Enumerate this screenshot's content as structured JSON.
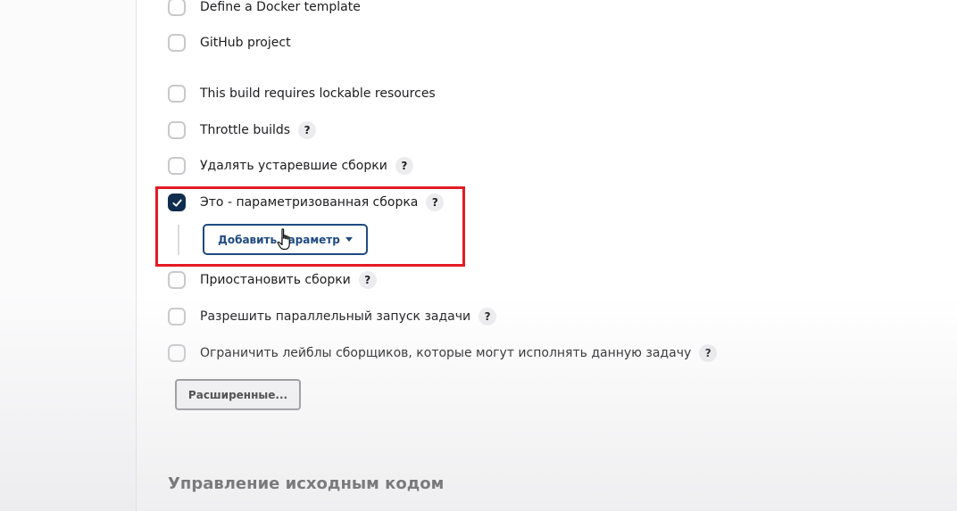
{
  "options": [
    {
      "label": "Define a Docker template",
      "checked": false,
      "help": false
    },
    {
      "label": "GitHub project",
      "checked": false,
      "help": false
    },
    {
      "label": "This build requires lockable resources",
      "checked": false,
      "help": false
    },
    {
      "label": "Throttle builds",
      "checked": false,
      "help": true
    },
    {
      "label": "Удалять устаревшие сборки",
      "checked": false,
      "help": true
    },
    {
      "label": "Это - параметризованная сборка",
      "checked": true,
      "help": true
    },
    {
      "label": "Приостановить сборки",
      "checked": false,
      "help": true
    },
    {
      "label": "Разрешить параллельный запуск задачи",
      "checked": false,
      "help": true
    },
    {
      "label": "Ограничить лейблы сборщиков, которые могут исполнять данную задачу",
      "checked": false,
      "help": true
    }
  ],
  "help_symbol": "?",
  "add_parameter_button": {
    "label": "Добавить параметр",
    "icon": "caret-down-icon"
  },
  "advanced_button": {
    "label": "Расширенные..."
  },
  "section_title": "Управление исходным кодом",
  "colors": {
    "checked": "#0f2e4f",
    "accent": "#1f4a82",
    "highlight": "#e31b23"
  }
}
